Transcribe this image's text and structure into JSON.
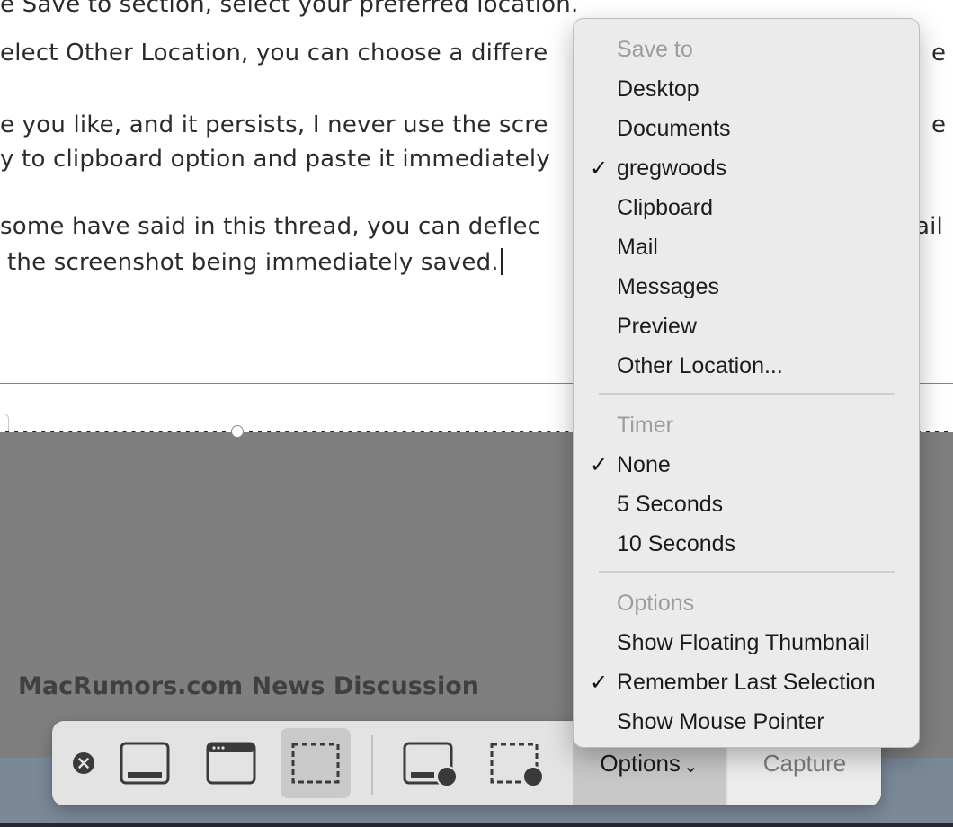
{
  "document": {
    "lines": [
      "e Save to section, select your preferred location.",
      "elect Other Location, you can choose a differe",
      "e a",
      "e you like, and it persists, I never use the scre",
      "e k",
      "y to clipboard option and paste it immediately",
      "some have said in this thread, you can deflec",
      "ail",
      "the screenshot being immediately saved."
    ]
  },
  "site_heading": "MacRumors.com News Discussion",
  "toolbar": {
    "options_label": "Options",
    "options_chevron": "⌄",
    "capture_label": "Capture",
    "close_icon": "close-icon",
    "buttons": [
      {
        "name": "capture-entire-screen-button",
        "icon": "entire-screen-icon"
      },
      {
        "name": "capture-window-button",
        "icon": "window-icon"
      },
      {
        "name": "capture-selection-button",
        "icon": "selection-icon",
        "active": true
      },
      {
        "name": "record-entire-screen-button",
        "icon": "record-screen-icon"
      },
      {
        "name": "record-selection-button",
        "icon": "record-selection-icon"
      }
    ]
  },
  "menu": {
    "check_glyph": "✓",
    "save_to": {
      "header": "Save to",
      "items": [
        "Desktop",
        "Documents",
        "gregwoods",
        "Clipboard",
        "Mail",
        "Messages",
        "Preview",
        "Other Location..."
      ],
      "selected": "gregwoods"
    },
    "timer": {
      "header": "Timer",
      "items": [
        "None",
        "5 Seconds",
        "10 Seconds"
      ],
      "selected": "None"
    },
    "options": {
      "header": "Options",
      "items": [
        "Show Floating Thumbnail",
        "Remember Last Selection",
        "Show Mouse Pointer"
      ],
      "selected": [
        "Remember Last Selection"
      ]
    }
  },
  "colors": {
    "menu_bg": "#ebebeb",
    "toolbar_bg": "#e3e3e3",
    "dim_overlay": "#7f7f7f",
    "header_text": "#9d9d9d"
  }
}
